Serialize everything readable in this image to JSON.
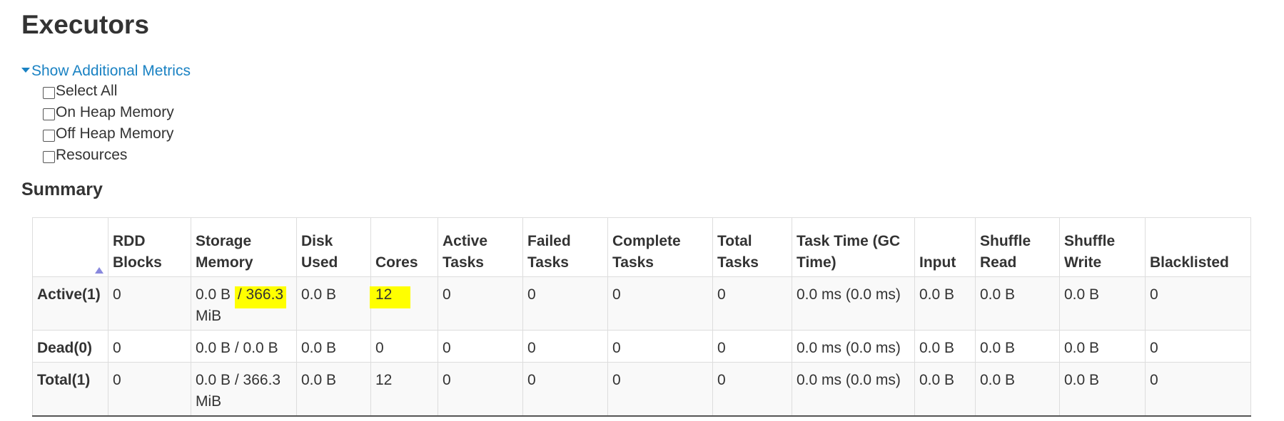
{
  "page": {
    "title": "Executors"
  },
  "metrics": {
    "toggle_label": "Show Additional Metrics",
    "options": [
      "Select All",
      "On Heap Memory",
      "Off Heap Memory",
      "Resources"
    ]
  },
  "summary": {
    "title": "Summary",
    "headers": [
      "RDD Blocks",
      "Storage Memory",
      "Disk Used",
      "Cores",
      "Active Tasks",
      "Failed Tasks",
      "Complete Tasks",
      "Total Tasks",
      "Task Time (GC Time)",
      "Input",
      "Shuffle Read",
      "Shuffle Write",
      "Blacklisted"
    ],
    "rows": [
      {
        "label": "Active(1)",
        "rdd_blocks": "0",
        "storage_used": "0.0 B",
        "storage_total": "/ 366.3",
        "storage_unit": "MiB",
        "disk_used": "0.0 B",
        "cores": "12",
        "active_tasks": "0",
        "failed_tasks": "0",
        "complete_tasks": "0",
        "total_tasks": "0",
        "task_time": "0.0 ms (0.0 ms)",
        "input": "0.0 B",
        "shuffle_read": "0.0 B",
        "shuffle_write": "0.0 B",
        "blacklisted": "0"
      },
      {
        "label": "Dead(0)",
        "rdd_blocks": "0",
        "storage_memory": "0.0 B / 0.0 B",
        "disk_used": "0.0 B",
        "cores": "0",
        "active_tasks": "0",
        "failed_tasks": "0",
        "complete_tasks": "0",
        "total_tasks": "0",
        "task_time": "0.0 ms (0.0 ms)",
        "input": "0.0 B",
        "shuffle_read": "0.0 B",
        "shuffle_write": "0.0 B",
        "blacklisted": "0"
      },
      {
        "label": "Total(1)",
        "rdd_blocks": "0",
        "storage_memory": "0.0 B / 366.3 MiB",
        "disk_used": "0.0 B",
        "cores": "12",
        "active_tasks": "0",
        "failed_tasks": "0",
        "complete_tasks": "0",
        "total_tasks": "0",
        "task_time": "0.0 ms (0.0 ms)",
        "input": "0.0 B",
        "shuffle_read": "0.0 B",
        "shuffle_write": "0.0 B",
        "blacklisted": "0"
      }
    ]
  },
  "colors": {
    "link": "#1a82c3",
    "highlight": "#ffff00",
    "sort_arrow": "#8888dd"
  },
  "icons": {
    "toggle": "caret-down-icon",
    "sort": "sort-ascending-icon"
  }
}
